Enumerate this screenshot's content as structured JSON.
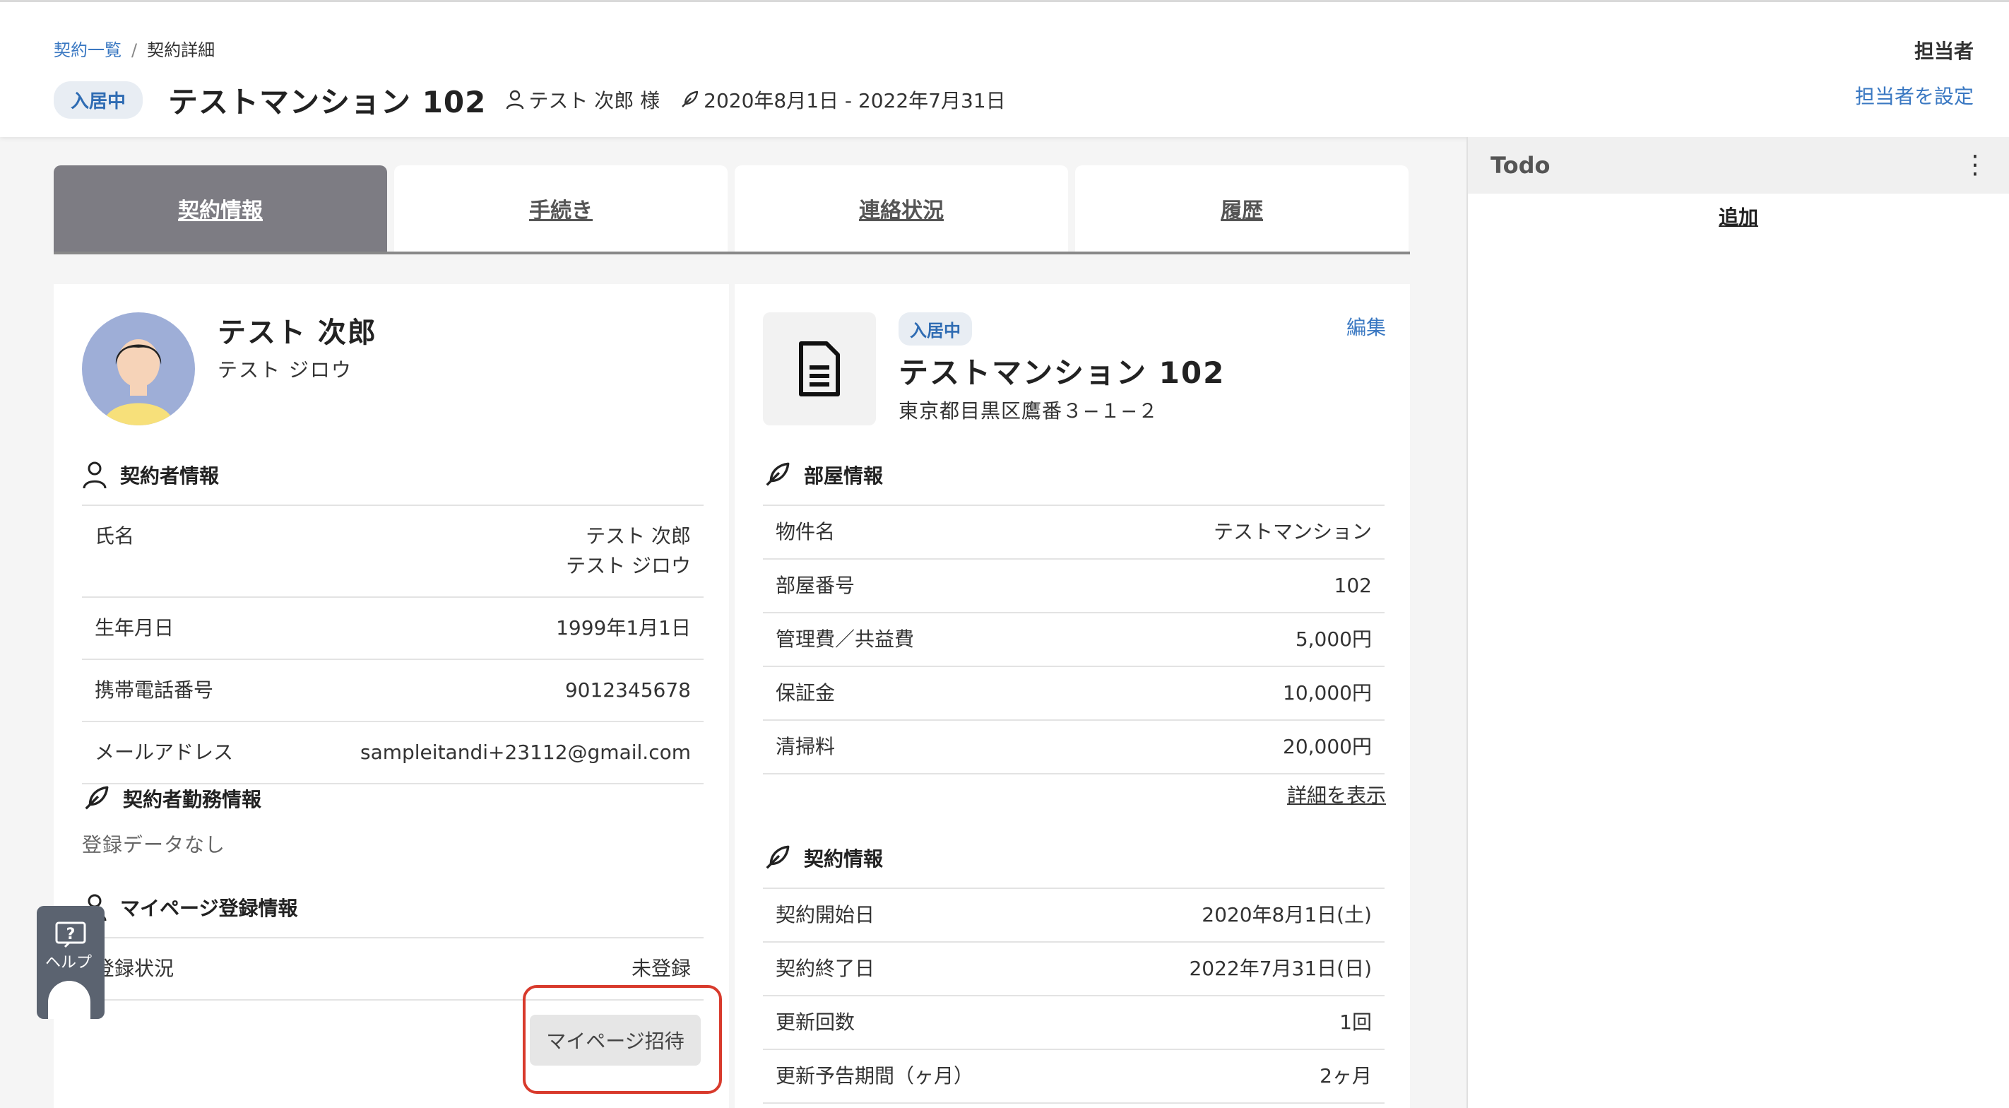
{
  "header": {
    "breadcrumb": {
      "link": "契約一覧",
      "separator": "/",
      "current": "契約詳細"
    },
    "status_badge": "入居中",
    "title": "テストマンション 102",
    "tenant": "テスト 次郎 様",
    "period": "2020年8月1日 - 2022年7月31日",
    "assignee_label": "担当者",
    "assignee_link": "担当者を設定"
  },
  "tabs": [
    {
      "label": "契約情報",
      "active": true
    },
    {
      "label": "手続き",
      "active": false
    },
    {
      "label": "連絡状況",
      "active": false
    },
    {
      "label": "履歴",
      "active": false
    }
  ],
  "person": {
    "name": "テスト 次郎",
    "kana": "テスト ジロウ"
  },
  "contractor_section": {
    "title": "契約者情報",
    "rows": [
      {
        "k": "氏名",
        "v": "テスト 次郎",
        "v2": "テスト ジロウ"
      },
      {
        "k": "生年月日",
        "v": "1999年1月1日"
      },
      {
        "k": "携帯電話番号",
        "v": "9012345678"
      },
      {
        "k": "メールアドレス",
        "v": "sampleitandi+23112@gmail.com"
      }
    ]
  },
  "work_section": {
    "title": "契約者勤務情報",
    "empty": "登録データなし"
  },
  "mypage_section": {
    "title": "マイページ登録情報",
    "rows": [
      {
        "k": "登録状況",
        "v": "未登録"
      }
    ],
    "invite_button": "マイページ招待"
  },
  "property": {
    "badge": "入居中",
    "edit": "編集",
    "name": "テストマンション 102",
    "address": "東京都目黒区鷹番３−１−２"
  },
  "room_section": {
    "title": "部屋情報",
    "rows": [
      {
        "k": "物件名",
        "v": "テストマンション"
      },
      {
        "k": "部屋番号",
        "v": "102"
      },
      {
        "k": "管理費／共益費",
        "v": "5,000円"
      },
      {
        "k": "保証金",
        "v": "10,000円"
      },
      {
        "k": "清掃料",
        "v": "20,000円"
      }
    ],
    "detail_link": "詳細を表示"
  },
  "contract_section": {
    "title": "契約情報",
    "rows": [
      {
        "k": "契約開始日",
        "v": "2020年8月1日(土)"
      },
      {
        "k": "契約終了日",
        "v": "2022年7月31日(日)"
      },
      {
        "k": "更新回数",
        "v": "1回"
      },
      {
        "k": "更新予告期間（ヶ月）",
        "v": "2ヶ月"
      }
    ]
  },
  "todo": {
    "title": "Todo",
    "add": "追加"
  },
  "help": {
    "label": "ヘルプ"
  }
}
